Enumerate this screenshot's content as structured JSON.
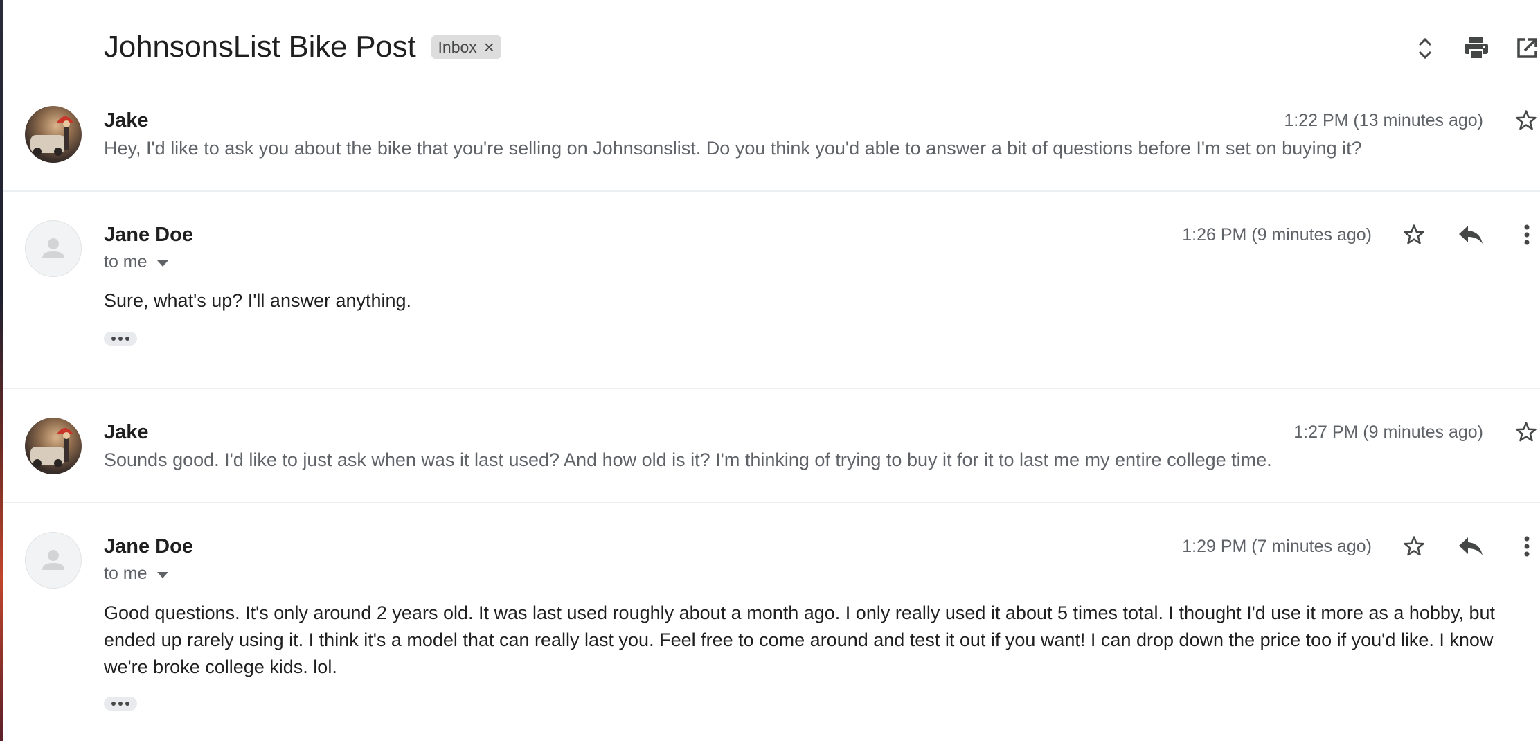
{
  "thread": {
    "subject": "JohnsonsList Bike Post",
    "label": "Inbox",
    "label_remove": "×"
  },
  "toolbar": {
    "icons": [
      "expand-collapse-icon",
      "print-icon",
      "open-new-window-icon"
    ]
  },
  "messages": [
    {
      "sender": "Jake",
      "time": "1:22 PM (13 minutes ago)",
      "snippet": "Hey, I'd like to ask you about the bike that you're selling on Johnsonslist. Do you think you'd able to answer a bit of questions before I'm set on buying it?",
      "collapsed": true
    },
    {
      "sender": "Jane Doe",
      "time": "1:26 PM (9 minutes ago)",
      "to": "to me",
      "body": "Sure, what's up? I'll answer anything.",
      "collapsed": false
    },
    {
      "sender": "Jake",
      "time": "1:27 PM (9 minutes ago)",
      "snippet": "Sounds good. I'd like to just ask when was it last used? And how old is it? I'm thinking of trying to buy it for it to last me my entire college time.",
      "collapsed": true
    },
    {
      "sender": "Jane Doe",
      "time": "1:29 PM (7 minutes ago)",
      "to": "to me",
      "body": "Good questions. It's only around 2 years old. It was last used roughly about a month ago. I only really used it about 5 times total. I thought I'd use it more as a hobby, but ended up rarely using it. I think it's a model that can really last you. Feel free to come around and test it out if you want! I can drop down the price too if you'd like. I know we're broke college kids. lol.",
      "collapsed": false
    }
  ],
  "colors": {
    "text_primary": "#1f1f1f",
    "text_secondary": "#5f6368",
    "chip_bg": "#dddddd",
    "divider": "#eceff1"
  }
}
